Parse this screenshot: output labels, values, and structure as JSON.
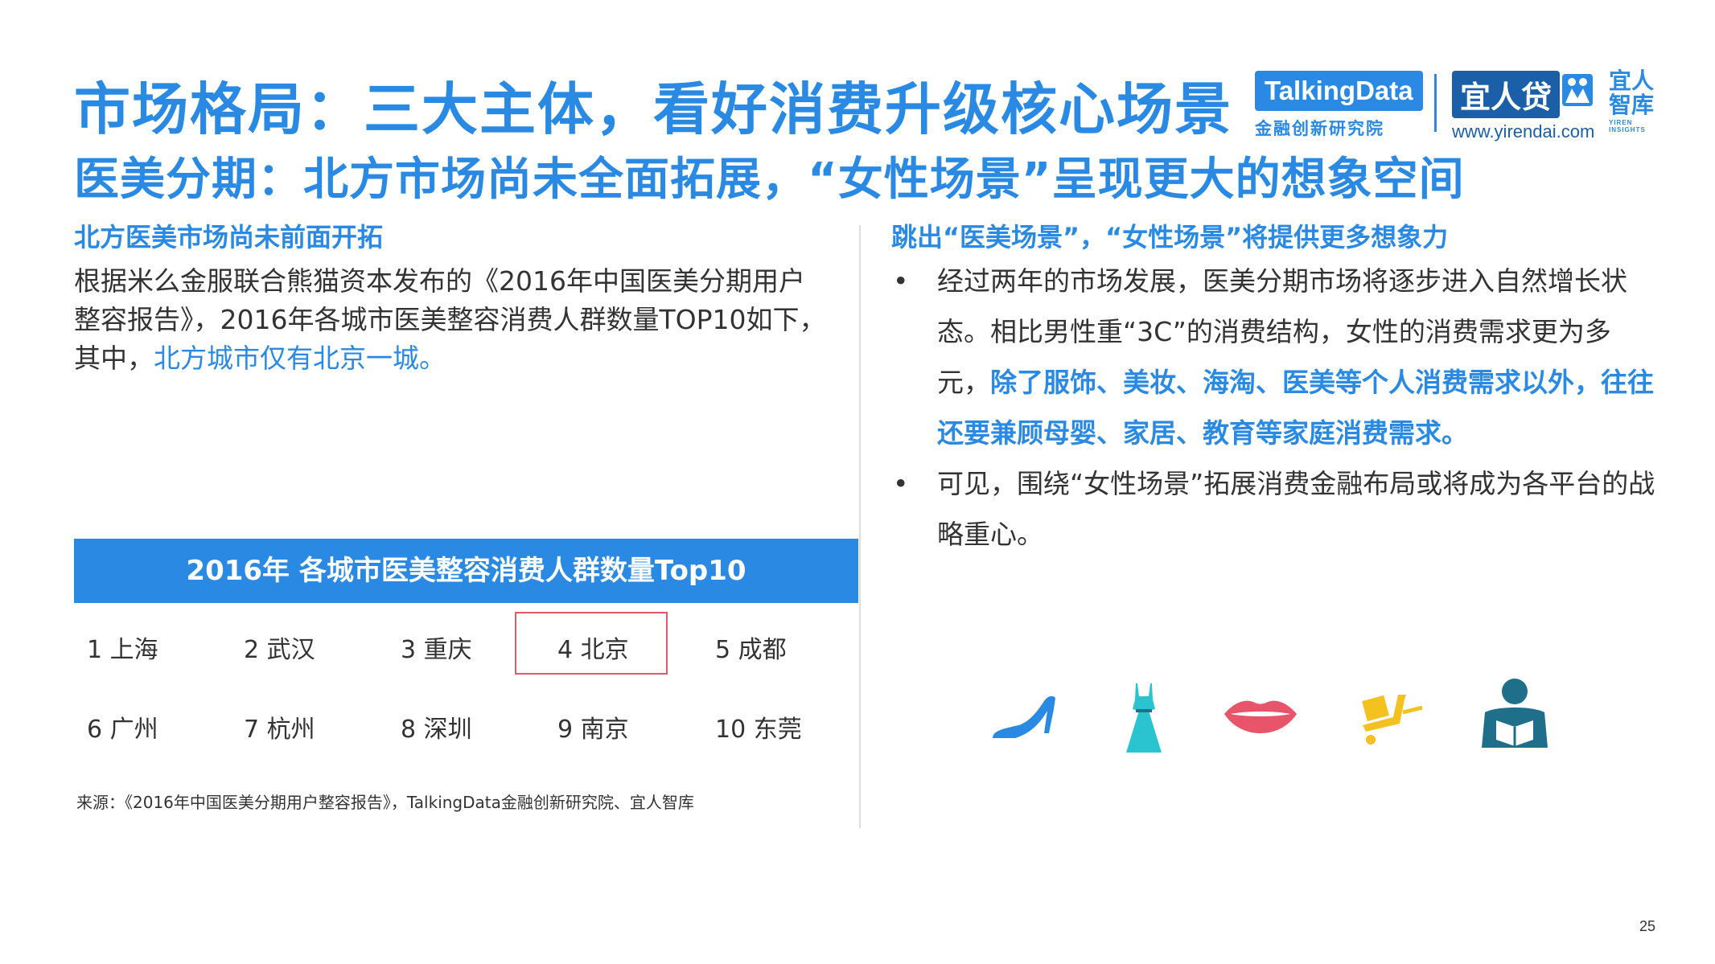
{
  "title": "市场格局：三大主体，看好消费升级核心场景",
  "subtitle": "医美分期：北方市场尚未全面拓展，“女性场景”呈现更大的想象空间",
  "logos": {
    "talkingdata": "TalkingData",
    "talkingdata_sub": "金融创新研究院",
    "yirendai": "宜人贷",
    "yirendai_site": "www.yirendai.com",
    "zhiku": "宜人智库",
    "zhiku_en": "YIREN INSIGHTS"
  },
  "left": {
    "heading": "北方医美市场尚未前面开拓",
    "para_text": "根据米么金服联合熊猫资本发布的《2016年中国医美分期用户整容报告》，2016年各城市医美整容消费人群数量TOP10如下，其中，",
    "para_highlight": "北方城市仅有北京一城。",
    "table_title": "2016年 各城市医美整容消费人群数量Top10",
    "cities": [
      "1 上海",
      "2 武汉",
      "3 重庆",
      "4 北京",
      "5 成都",
      "6 广州",
      "7 杭州",
      "8 深圳",
      "9 南京",
      "10 东莞"
    ],
    "highlighted_city": "4 北京",
    "source": "来源：《2016年中国医美分期用户整容报告》，TalkingData金融创新研究院、宜人智库"
  },
  "right": {
    "heading": "跳出“医美场景”，“女性场景”将提供更多想象力",
    "bullet_char": "•",
    "bullet1_text": "经过两年的市场发展，医美分期市场将逐步进入自然增长状态。相比男性重“3C”的消费结构，女性的消费需求更为多元，",
    "bullet1_bold": "除了服饰、美妆、海淘、医美等个人消费需求以外，往往还要兼顾母婴、家居、教育等家庭消费需求。",
    "bullet2_text": "可见，围绕“女性场景”拓展消费金融布局或将成为各平台的战略重心。",
    "icons": [
      "high-heel-icon",
      "dress-icon",
      "lips-icon",
      "shopping-cart-icon",
      "reading-person-icon"
    ]
  },
  "colors": {
    "brand_blue": "#2a8ae3",
    "cyan": "#29c4cf",
    "pink": "#e8546a",
    "yellow": "#f4c21e",
    "teal_dark": "#1f6f8b",
    "highlight_border": "#e05a6a"
  },
  "page_number": "25"
}
